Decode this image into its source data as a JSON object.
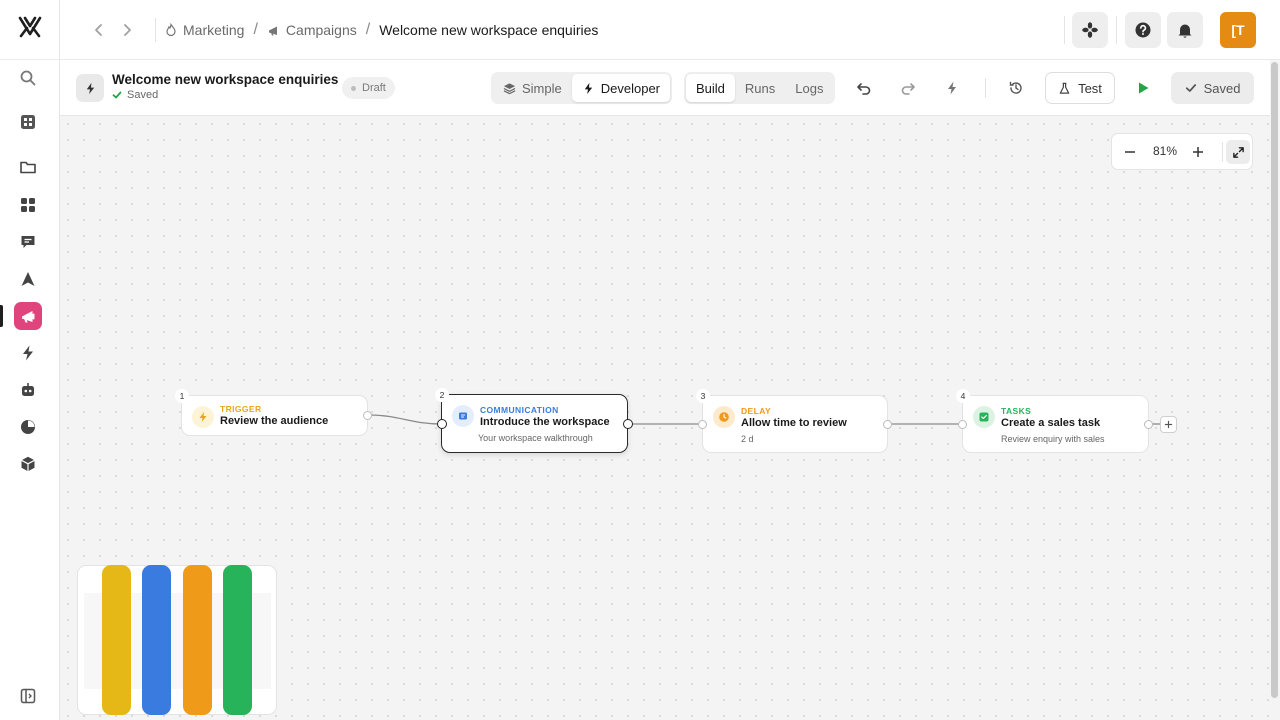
{
  "breadcrumbs": [
    {
      "label": "Marketing"
    },
    {
      "label": "Campaigns"
    },
    {
      "label": "Welcome new workspace enquiries"
    }
  ],
  "avatar": {
    "initials": "[T",
    "color": "#e58a12"
  },
  "flow": {
    "title": "Welcome new workspace enquiries",
    "save_status": "Saved",
    "badge": "Draft"
  },
  "mode_toggle": [
    {
      "label": "Simple",
      "icon": "layers-icon",
      "selected": false
    },
    {
      "label": "Developer",
      "icon": "bolt-icon",
      "selected": true
    }
  ],
  "view_tabs": [
    {
      "label": "Build",
      "selected": true
    },
    {
      "label": "Runs",
      "selected": false
    },
    {
      "label": "Logs",
      "selected": false
    }
  ],
  "actions": {
    "test_label": "Test",
    "saved_label": "Saved"
  },
  "zoom": {
    "value": "81%"
  },
  "nodes": [
    {
      "number": "1",
      "type": "TRIGGER",
      "title": "Review the audience",
      "subtitle": "",
      "color": "#e6a817",
      "icon": "bolt-icon"
    },
    {
      "number": "2",
      "type": "COMMUNICATION",
      "title": "Introduce the workspace",
      "subtitle": "Your workspace walkthrough",
      "color": "#3a7be0",
      "icon": "message-icon"
    },
    {
      "number": "3",
      "type": "DELAY",
      "title": "Allow time to review",
      "subtitle": "2 d",
      "color": "#f09a1a",
      "icon": "clock-icon"
    },
    {
      "number": "4",
      "type": "TASKS",
      "title": "Create a sales task",
      "subtitle": "Review enquiry with sales",
      "color": "#27b35a",
      "icon": "check-icon"
    }
  ],
  "colors": {
    "accent": "#e0447c",
    "play": "#22a447"
  }
}
